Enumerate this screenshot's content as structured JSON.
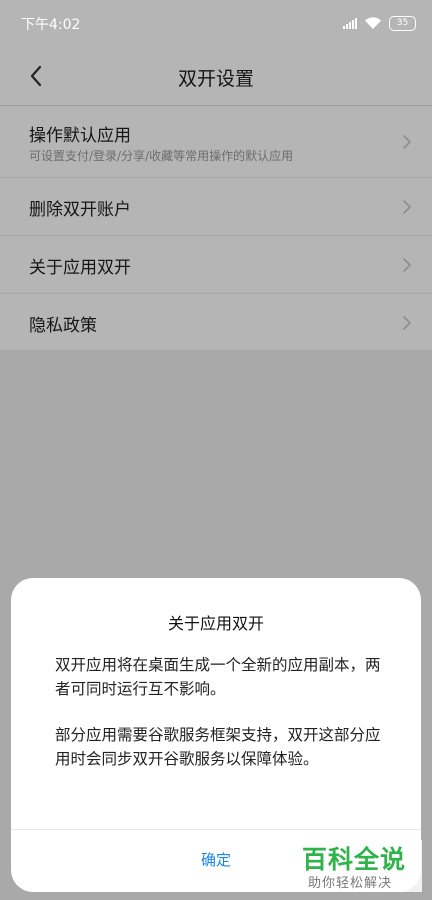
{
  "status_bar": {
    "time": "下午4:02",
    "battery": "35",
    "icons": [
      "signal-icon",
      "wifi-icon",
      "battery-icon"
    ]
  },
  "header": {
    "title": "双开设置",
    "back_icon": "back-arrow-icon"
  },
  "settings": {
    "items": [
      {
        "label": "操作默认应用",
        "subtitle": "可设置支付/登录/分享/收藏等常用操作的默认应用"
      },
      {
        "label": "删除双开账户"
      },
      {
        "label": "关于应用双开"
      },
      {
        "label": "隐私政策"
      }
    ]
  },
  "dialog": {
    "title": "关于应用双开",
    "paragraphs": [
      "双开应用将在桌面生成一个全新的应用副本，两者可同时运行互不影响。",
      "部分应用需要谷歌服务框架支持，双开这部分应用时会同步双开谷歌服务以保障体验。"
    ],
    "ok_label": "确定",
    "ok_color": "#1b85e8"
  },
  "watermark": {
    "main": "百科全说",
    "sub": "助你轻松解决",
    "color": "#2fb34a"
  }
}
